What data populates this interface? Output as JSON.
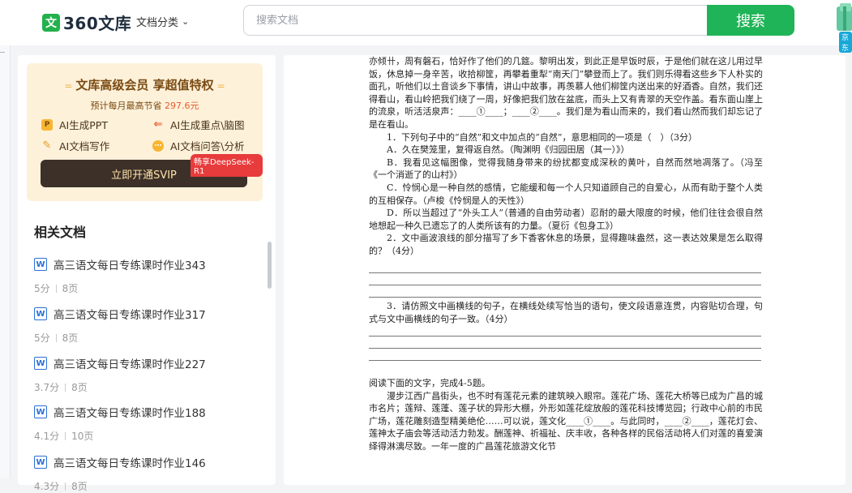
{
  "header": {
    "logo_mark": "文",
    "logo_text": "360文库",
    "category_label": "文档分类",
    "search_placeholder": "搜索文档",
    "search_button": "搜索",
    "gift_label": "京东"
  },
  "vip_card": {
    "title": "文库高级会员 享超值特权",
    "subtitle_prefix": "预计每月最高节省",
    "subtitle_amount": "297.6元",
    "features": [
      "AI生成PPT",
      "AI生成重点\\脑图",
      "AI文档写作",
      "AI文档问答\\分析"
    ],
    "feature_icons": [
      "ppt-icon",
      "mindmap-icon",
      "write-icon",
      "qa-icon"
    ],
    "deepseek_badge": "畅享DeepSeek-R1",
    "cta": "立即开通SVIP"
  },
  "related": {
    "title": "相关文档",
    "items": [
      {
        "title": "高三语文每日专练课时作业343",
        "score": "5分",
        "pages": "8页"
      },
      {
        "title": "高三语文每日专练课时作业317",
        "score": "5分",
        "pages": "8页"
      },
      {
        "title": "高三语文每日专练课时作业227",
        "score": "3.7分",
        "pages": "8页"
      },
      {
        "title": "高三语文每日专练课时作业188",
        "score": "4.1分",
        "pages": "10页"
      },
      {
        "title": "高三语文每日专练课时作业146",
        "score": "4.3分",
        "pages": "8页"
      }
    ]
  },
  "document": {
    "para1": "亦倾卄，周有磐石，恰好作了他们的几筵。黎明出发，到此正是早饭时辰，于是他们就在这儿用过早饭，休息掉一身辛苦，收拾柳筐，再攀着重犁“南天门”攀登而上了。我们则乐得看这些乡下人朴实的面孔，听他们以土音谈乡下事情，讲山中故事，再羡慕人他们柳筐内送出来的好酒香。自然，我们还得看山，看山岭把我们绕了一周，好像把我们放在盆底，而头上又有青翠的天空作盖。看东面山崖上的流泉，听活活泉声：____①____；____②____。我们是为看山而来的，我们看山然而我们却忘记了是在看山。",
    "q1": "1．下列句子中的“自然”和文中加点的“自然”，意思相同的一项是（　）（3分）",
    "q1a": "A．久在樊笼里，复得返自然。（陶渊明《归园田居（其一）》）",
    "q1b": "B．我看见这幅图像，觉得我随身带来的纷扰都变成深秋的黄叶，自然而然地凋落了。（冯至《一个消逝了的山村》）",
    "q1c": "C．怜悯心是一种自然的感情，它能缓和每一个人只知道顾自己的自爱心，从而有助于整个人类的互相保存。（卢梭《怜悯是人的天性》）",
    "q1d": "D．所以当超过了“外头工人”（普通的自由劳动者）忍耐的最大限度的时候，他们往往会很自然地想起一种久已遗忘了的人类所该有的力量。（夏衍《包身工》）",
    "q2": "2．文中画波浪线的部分描写了乡下香客休息的场景，显得趣味盎然，这一表达效果是怎么取得的？（4分）",
    "q3": "3．请仿照文中画横线的句子，在横线处续写恰当的语句，使文段语意连贯，内容贴切合理，句式与文中画横线的句子一致。（4分）",
    "read_intro": "阅读下面的文字，完成4-5题。",
    "para2": "漫步江西广昌街头，也不时有莲花元素的建筑映入眼帘。莲花广场、莲花大桥等已成为广昌的城市名片；莲辩、莲蓬、莲子状的异形大棚，外形如莲花绽放般的莲花科技博览园；行政中心前的市民广场，莲花雕刻造型精美绝伦……可以说，莲文化____①____。与此同时，____②____，莲花灯会、莲神太子庙会等活动活力勃发。酬莲神、祈福祉、庆丰收，各种各样的民俗活动将人们对莲的喜爱演绎得淋漓尽致。一年一度的广昌莲花旅游文化节"
  }
}
